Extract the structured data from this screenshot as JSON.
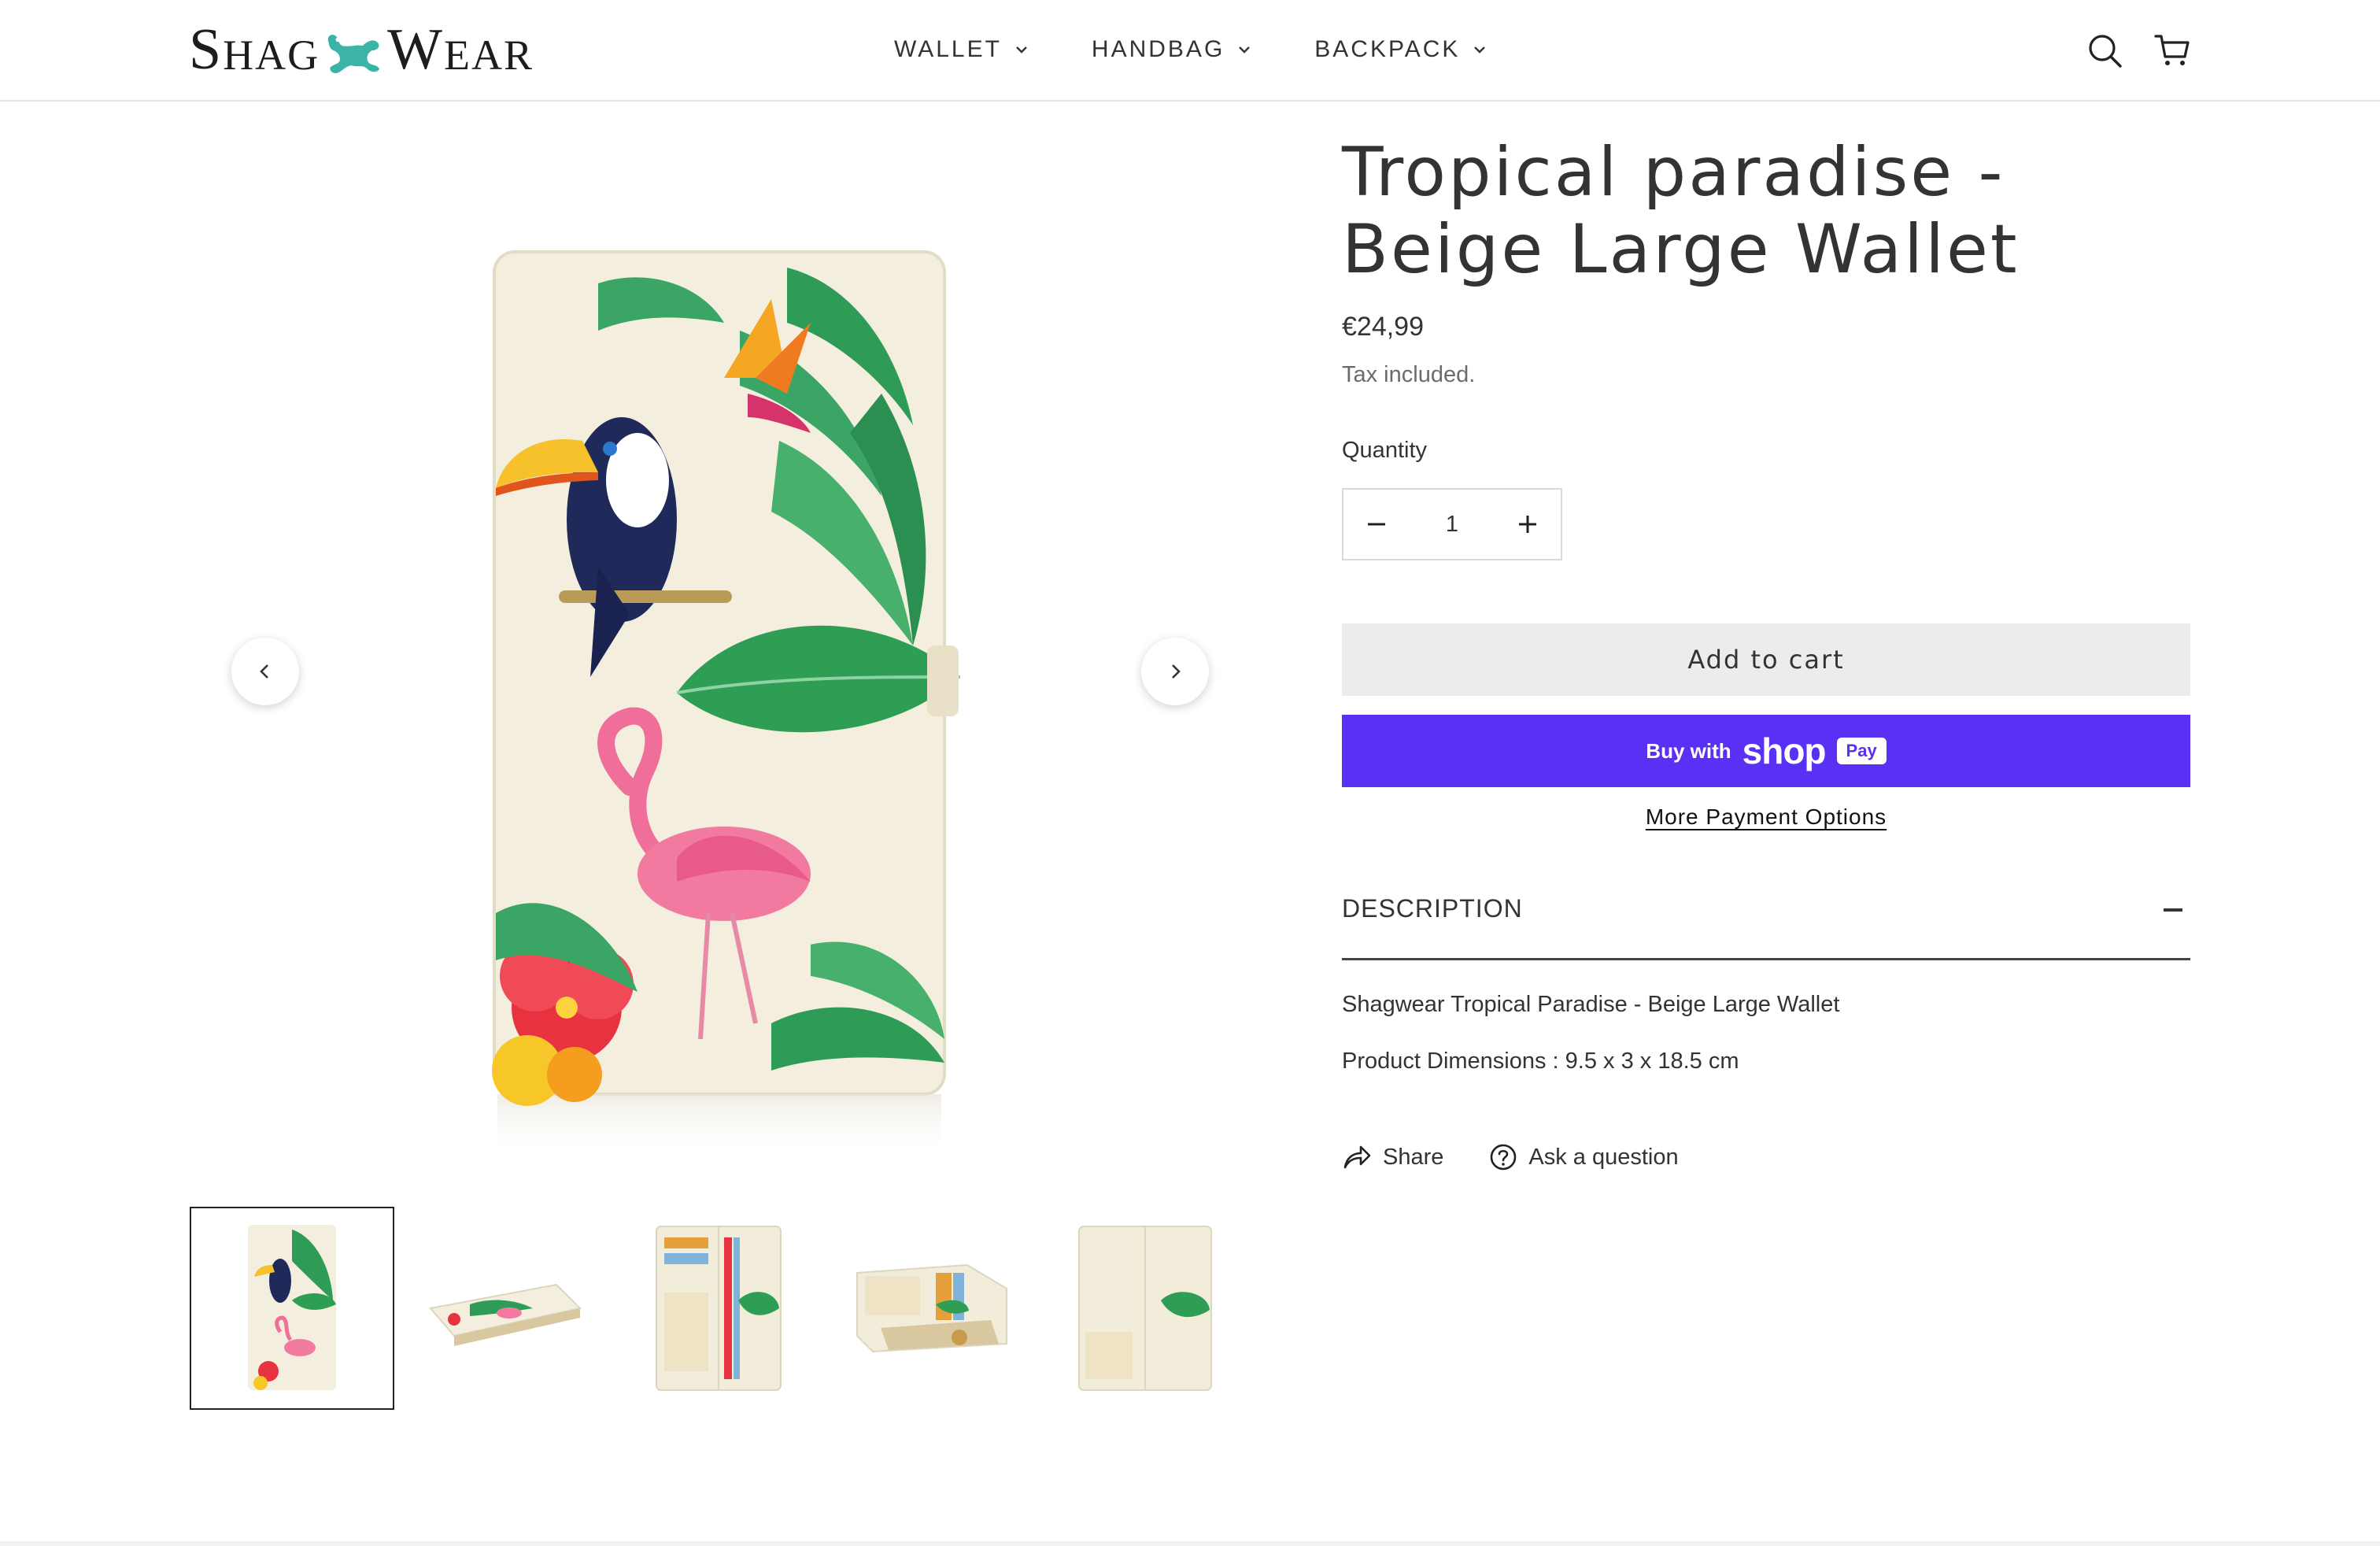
{
  "brand": {
    "logo_left": "S",
    "logo_left_rest": "HAG",
    "logo_right": "W",
    "logo_right_rest": "EAR",
    "accent_color": "#3bb4a7"
  },
  "nav": {
    "items": [
      {
        "label": "WALLET",
        "icon": "chevron-down-icon"
      },
      {
        "label": "HANDBAG",
        "icon": "chevron-down-icon"
      },
      {
        "label": "BACKPACK",
        "icon": "chevron-down-icon"
      }
    ],
    "search_icon": "search-icon",
    "cart_icon": "cart-icon"
  },
  "gallery": {
    "prev_icon": "chevron-left-icon",
    "next_icon": "chevron-right-icon",
    "thumbnails": [
      {
        "name": "front-view",
        "active": true
      },
      {
        "name": "side-view",
        "active": false
      },
      {
        "name": "open-inside-view",
        "active": false
      },
      {
        "name": "coin-pocket-view",
        "active": false
      },
      {
        "name": "back-open-view",
        "active": false
      }
    ]
  },
  "product": {
    "title": "Tropical paradise - Beige Large Wallet",
    "price": "€24,99",
    "tax_note": "Tax included.",
    "quantity_label": "Quantity",
    "quantity_value": "1",
    "add_to_cart": "Add to cart",
    "buy_with": "Buy with",
    "shop_word": "shop",
    "pay_badge": "Pay",
    "more_payment": "More Payment Options",
    "shop_pay_color": "#5a31f4",
    "description_heading": "DESCRIPTION",
    "description_text": "Shagwear Tropical Paradise - Beige Large Wallet",
    "dimensions_text": "Product Dimensions  :  9.5 x 3 x 18.5 cm",
    "share_label": "Share",
    "ask_label": "Ask a question"
  }
}
